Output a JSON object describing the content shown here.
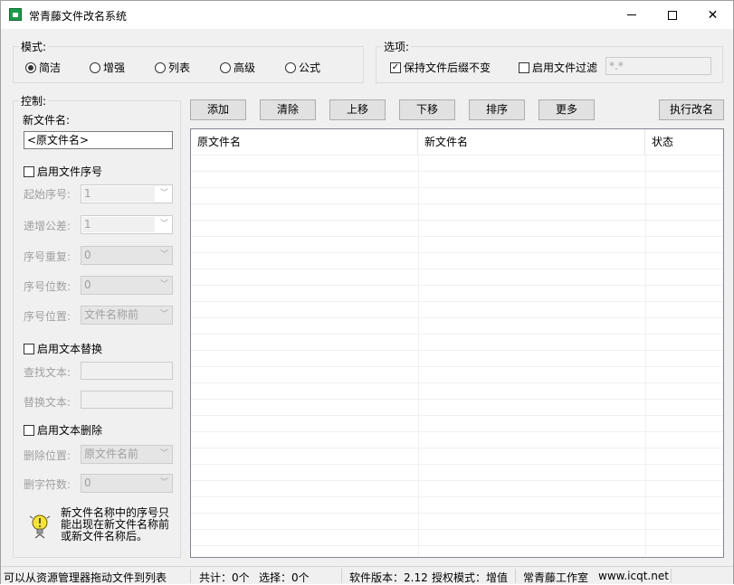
{
  "window": {
    "title": "常青藤文件改名系统",
    "app_icon": "app-icon"
  },
  "mode": {
    "title": "模式:",
    "options": [
      "简洁",
      "增强",
      "列表",
      "高级",
      "公式"
    ],
    "selected": "简洁"
  },
  "options": {
    "title": "选项:",
    "keep_ext": {
      "label": "保持文件后缀不变",
      "checked": true
    },
    "filter": {
      "label": "启用文件过滤",
      "checked": false,
      "value": "*.*"
    }
  },
  "control": {
    "title": "控制:",
    "new_name_label": "新文件名:",
    "new_name_value": "<原文件名>",
    "seq": {
      "enable_label": "启用文件序号",
      "start_label": "起始序号:",
      "start_value": "1",
      "step_label": "递增公差:",
      "step_value": "1",
      "repeat_label": "序号重复:",
      "repeat_value": "0",
      "digits_label": "序号位数:",
      "digits_value": "0",
      "pos_label": "序号位置:",
      "pos_value": "文件名称前"
    },
    "replace": {
      "enable_label": "启用文本替换",
      "find_label": "查找文本:",
      "replace_label": "替换文本:"
    },
    "delete": {
      "enable_label": "启用文本删除",
      "pos_label": "删除位置:",
      "pos_value": "原文件名前",
      "count_label": "删字符数:",
      "count_value": "0"
    },
    "tip": "新文件名称中的序号只能出现在新文件名称前或新文件名称后。"
  },
  "toolbar": {
    "add": "添加",
    "clear": "清除",
    "up": "上移",
    "down": "下移",
    "sort": "排序",
    "more": "更多",
    "execute": "执行改名"
  },
  "list": {
    "columns": [
      "原文件名",
      "新文件名",
      "状态"
    ],
    "rows": []
  },
  "status": {
    "hint": "可以从资源管理器拖动文件到列表",
    "total": "共计：0个",
    "selected": "选择：0个",
    "version": "软件版本：2.12",
    "license": "授权模式：增值",
    "studio": "常青藤工作室",
    "website": "www.icqt.net"
  }
}
